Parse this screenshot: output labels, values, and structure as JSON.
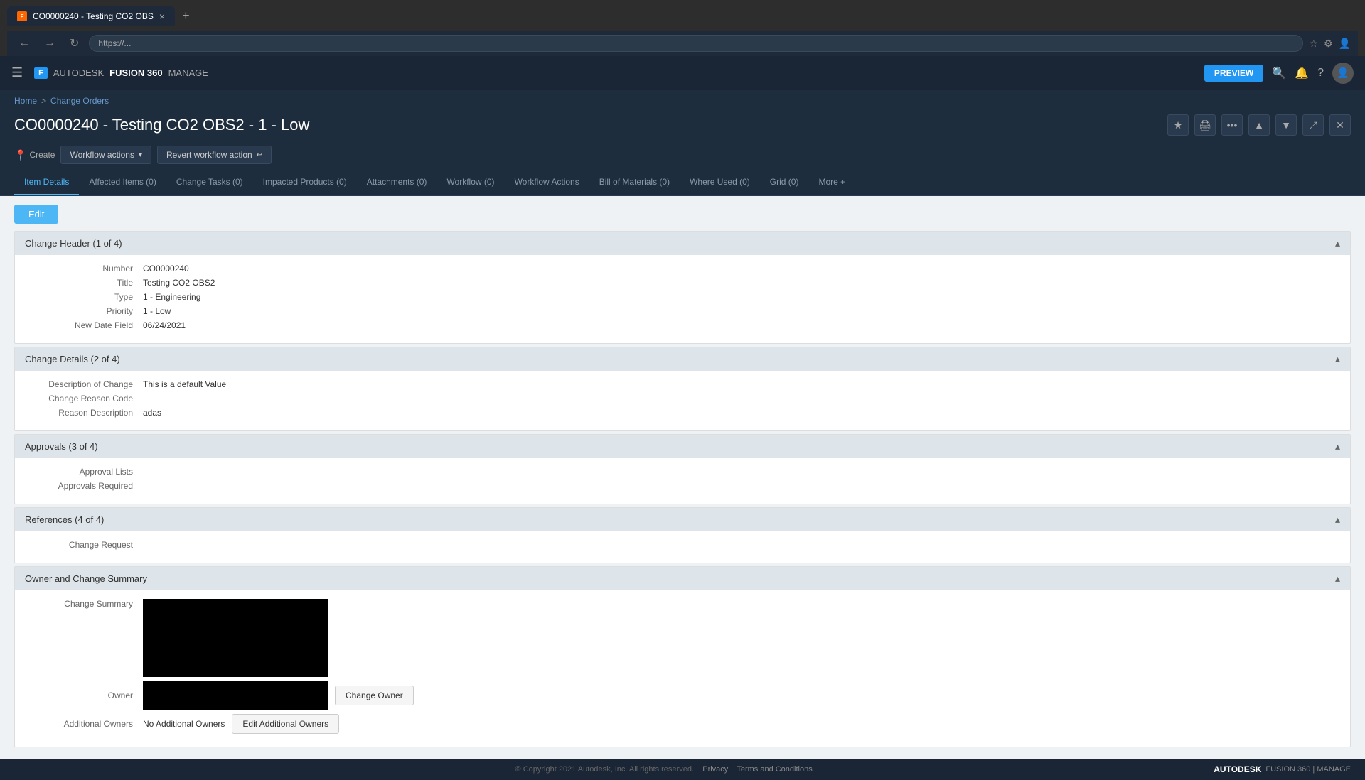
{
  "browser": {
    "tab_label": "CO0000240 - Testing CO2 OBS",
    "tab_close": "×",
    "tab_new": "+",
    "address_bar": "https://..."
  },
  "topnav": {
    "brand_logo": "F",
    "brand_prefix": "AUTODESK",
    "brand_product": "FUSION 360",
    "brand_suffix": "MANAGE",
    "preview_label": "PREVIEW"
  },
  "breadcrumb": {
    "home": "Home",
    "separator": ">",
    "current": "Change Orders"
  },
  "page": {
    "title": "CO0000240 - Testing CO2 OBS2 - 1 - Low"
  },
  "toolbar": {
    "create_label": "Create",
    "workflow_actions_label": "Workflow actions",
    "revert_label": "Revert workflow action"
  },
  "tabs": [
    {
      "label": "Item Details",
      "active": true,
      "count": null
    },
    {
      "label": "Affected Items (0)",
      "active": false
    },
    {
      "label": "Change Tasks (0)",
      "active": false
    },
    {
      "label": "Impacted Products (0)",
      "active": false
    },
    {
      "label": "Attachments (0)",
      "active": false
    },
    {
      "label": "Workflow (0)",
      "active": false
    },
    {
      "label": "Workflow Actions",
      "active": false
    },
    {
      "label": "Bill of Materials (0)",
      "active": false
    },
    {
      "label": "Where Used (0)",
      "active": false
    },
    {
      "label": "Grid (0)",
      "active": false
    },
    {
      "label": "More +",
      "active": false
    }
  ],
  "edit_button": "Edit",
  "sections": {
    "change_header": {
      "title": "Change Header (1 of 4)",
      "number_label": "Number",
      "number_value": "CO0000240",
      "title_label": "Title",
      "title_value": "Testing CO2 OBS2",
      "type_label": "Type",
      "type_value": "1 - Engineering",
      "priority_label": "Priority",
      "priority_value": "1 - Low",
      "date_label": "New Date Field",
      "date_value": "06/24/2021"
    },
    "change_details": {
      "title": "Change Details (2 of 4)",
      "desc_label": "Description of Change",
      "desc_value": "This is a default Value",
      "reason_code_label": "Change Reason Code",
      "reason_code_value": "",
      "reason_desc_label": "Reason Description",
      "reason_desc_value": "adas"
    },
    "approvals": {
      "title": "Approvals (3 of 4)",
      "approval_lists_label": "Approval Lists",
      "approval_lists_value": "",
      "approvals_required_label": "Approvals Required",
      "approvals_required_value": ""
    },
    "references": {
      "title": "References (4 of 4)",
      "change_request_label": "Change Request",
      "change_request_value": ""
    },
    "owner_summary": {
      "title": "Owner and Change Summary",
      "change_summary_label": "Change Summary",
      "owner_label": "Owner",
      "additional_owners_label": "Additional Owners",
      "additional_owners_value": "No Additional Owners",
      "change_owner_btn": "Change Owner",
      "edit_additional_owners_btn": "Edit Additional Owners"
    }
  },
  "footer": {
    "copyright": "© Copyright 2021 Autodesk, Inc. All rights reserved.",
    "privacy": "Privacy",
    "terms": "Terms and Conditions",
    "brand": "AUTODESK",
    "product": "FUSION 360 | MANAGE"
  },
  "icons": {
    "star": "★",
    "print": "🖨",
    "more": "•••",
    "up": "▲",
    "down": "▼",
    "expand": "⤢",
    "close": "✕",
    "pin": "📍",
    "chevron_down": "▾",
    "chevron_up": "▴",
    "search": "🔍",
    "bell": "🔔",
    "help": "?",
    "collapse": "−"
  }
}
